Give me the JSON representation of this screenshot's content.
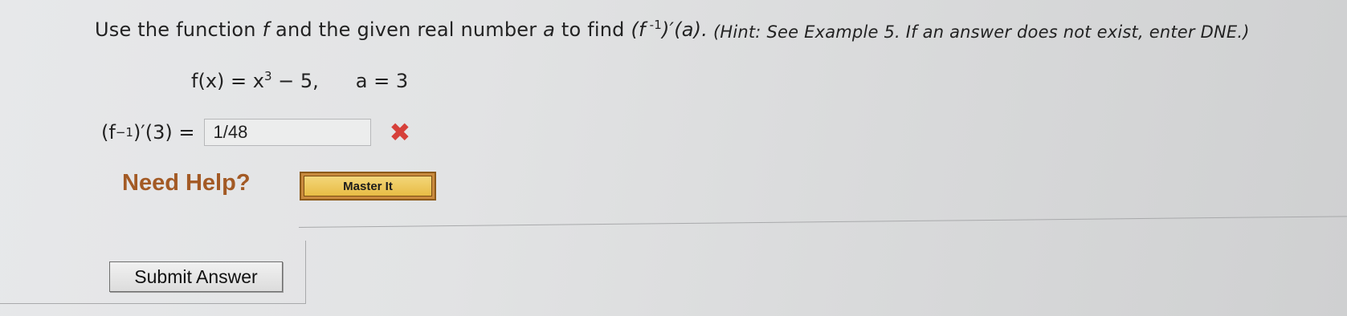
{
  "question": {
    "intro": "Use the function ",
    "f": "f",
    "mid": " and the given real number ",
    "a": "a",
    "to_find": " to find ",
    "expr_open": "(f",
    "expr_sup": " -1",
    "expr_close": ")′(a).",
    "hint": " (Hint: See Example 5. If an answer does not exist, enter DNE.)"
  },
  "formula": {
    "fx": "f(x) = x",
    "exp": "3",
    "rest": " − 5,",
    "a_def": "a = 3"
  },
  "answer": {
    "lhs_open": "(f",
    "lhs_sup": " −1",
    "lhs_close": ")′(3)  =",
    "value": "1/48",
    "status_icon": "✖"
  },
  "help": {
    "need_help": "Need Help?",
    "master_it": "Master It"
  },
  "submit": {
    "label": "Submit Answer"
  },
  "colors": {
    "wrong": "#d6403a",
    "need_help": "#a35a25",
    "master_button": "#e8bc45"
  }
}
